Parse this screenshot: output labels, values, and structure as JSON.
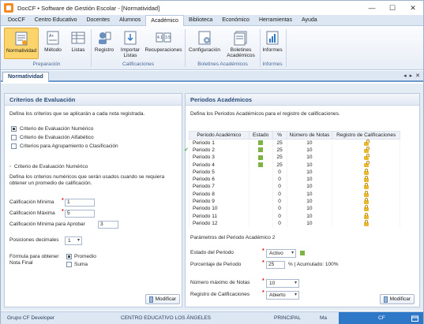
{
  "window": {
    "title": "DocCF • Software de Gestión Escolar - [Normatividad]",
    "minimize": "—",
    "maximize": "☐",
    "close": "✕"
  },
  "ribbon_tabs": [
    "DocCF",
    "Centro Educativo",
    "Docentes",
    "Alumnos",
    "Académico",
    "Biblioteca",
    "Económico",
    "Herramientas",
    "Ayuda"
  ],
  "ribbon": {
    "preparacion": {
      "label": "Preparación",
      "buttons": [
        "Normatividad",
        "Método",
        "Listas"
      ]
    },
    "calificaciones": {
      "label": "Calificaciones",
      "buttons": [
        "Registro",
        "Importar\nListas",
        "Recuperaciones"
      ]
    },
    "boletines": {
      "label": "Boletines Académicos",
      "buttons": [
        "Configuración",
        "Boletines\nAcadémicos"
      ]
    },
    "informes": {
      "label": "Informes",
      "buttons": [
        "Informes"
      ]
    }
  },
  "doc_tab": {
    "label": "Normatividad",
    "nav_left": "◂",
    "nav_right": "▸",
    "close": "✕"
  },
  "criterios": {
    "title": "Criterios de Evaluación",
    "description": "Defina los criterios que se aplicarán a cada nota registrada.",
    "options": [
      {
        "label": "Criterio de Evaluación Numérico",
        "checked": true
      },
      {
        "label": "Criterio de Evaluación Alfabético",
        "checked": false
      },
      {
        "label": "Criterios para Agrupamiento o Clasificación",
        "checked": false
      }
    ],
    "section_title": "Criterio de Evaluación Numérico",
    "section_desc": "Defina los criterios numéricos que serán usados cuando se requiera obtener un promedio de calificación.",
    "min_label": "Calificación Mínima",
    "min_value": "1",
    "max_label": "Calificación Máxima",
    "max_value": "5",
    "min_approve_label": "Calificación Mínima para Aprobar",
    "min_approve_value": "3",
    "decimals_label": "Posiciones decimales",
    "decimals_value": "1",
    "formula_label": "Fórmula para obtener Nota Final",
    "formula_options": [
      {
        "label": "Promedio",
        "checked": true
      },
      {
        "label": "Suma",
        "checked": false
      }
    ],
    "modify_button": "Modificar"
  },
  "periodos": {
    "title": "Periodos Académicos",
    "description": "Defina los Periodos Académicos para el registro de calificaciones.",
    "columns": [
      "Periodo Académico",
      "Estado",
      "%",
      "Número de Notas",
      "Registro de Calificaciones"
    ],
    "rows": [
      {
        "name": "Periodo 1",
        "active": true,
        "pct": "25",
        "notas": "10",
        "lock": "open",
        "current": false
      },
      {
        "name": "Periodo 2",
        "active": true,
        "pct": "25",
        "notas": "10",
        "lock": "open",
        "current": true
      },
      {
        "name": "Periodo 3",
        "active": true,
        "pct": "25",
        "notas": "10",
        "lock": "open",
        "current": false
      },
      {
        "name": "Periodo 4",
        "active": true,
        "pct": "25",
        "notas": "10",
        "lock": "open",
        "current": false
      },
      {
        "name": "Periodo 5",
        "active": false,
        "pct": "0",
        "notas": "10",
        "lock": "closed",
        "current": false
      },
      {
        "name": "Periodo 6",
        "active": false,
        "pct": "0",
        "notas": "10",
        "lock": "closed",
        "current": false
      },
      {
        "name": "Periodo 7",
        "active": false,
        "pct": "0",
        "notas": "10",
        "lock": "closed",
        "current": false
      },
      {
        "name": "Periodo 8",
        "active": false,
        "pct": "0",
        "notas": "10",
        "lock": "closed",
        "current": false
      },
      {
        "name": "Periodo 9",
        "active": false,
        "pct": "0",
        "notas": "10",
        "lock": "closed",
        "current": false
      },
      {
        "name": "Periodo 10",
        "active": false,
        "pct": "0",
        "notas": "10",
        "lock": "closed",
        "current": false
      },
      {
        "name": "Periodo 11",
        "active": false,
        "pct": "0",
        "notas": "10",
        "lock": "closed",
        "current": false
      },
      {
        "name": "Periodo 12",
        "active": false,
        "pct": "0",
        "notas": "10",
        "lock": "closed",
        "current": false
      }
    ],
    "params_title": "Parámetros del Periodo Académico 2",
    "estado_label": "Estado del Periodo",
    "estado_value": "Activo",
    "porcentaje_label": "Porcentaje de Periodo",
    "porcentaje_value": "25",
    "acumulado_text": "% | Acumulado: 100%",
    "max_notas_label": "Número máximo de Notas",
    "max_notas_value": "10",
    "registro_label": "Registro de Calificaciones",
    "registro_value": "Abierto",
    "modify_button": "Modificar"
  },
  "statusbar": {
    "user": "Grupo CF Developer",
    "school": "CENTRO EDUCATIVO LOS ÁNGELES",
    "sede": "PRINCIPAL",
    "jornada": "Ma",
    "brand": "CF"
  },
  "colors": {
    "accent": "#2f78c7",
    "selected_ribbon": "#fbd56b",
    "active_state": "#7cb342",
    "required": "#dd1111"
  }
}
